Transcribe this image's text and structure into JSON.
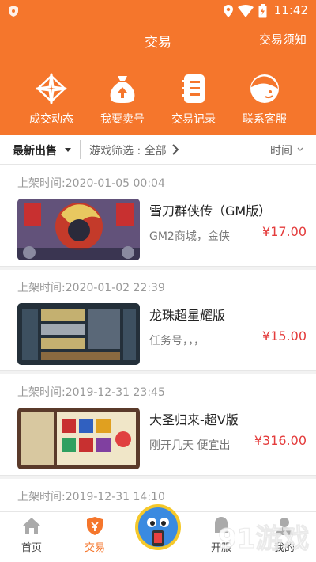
{
  "status_bar": {
    "time": "11:42"
  },
  "header": {
    "title": "交易",
    "notice_link": "交易须知",
    "features": [
      {
        "label": "成交动态",
        "icon": "deal-activity-icon"
      },
      {
        "label": "我要卖号",
        "icon": "money-bag-icon"
      },
      {
        "label": "交易记录",
        "icon": "record-book-icon"
      },
      {
        "label": "联系客服",
        "icon": "customer-service-icon"
      }
    ]
  },
  "filter_bar": {
    "sort_label": "最新出售",
    "game_filter": "游戏筛选 : 全部",
    "time_label": "时间"
  },
  "listings": [
    {
      "listed_time": "上架时间:2020-01-05 00:04",
      "name": "雪刀群侠传（GM版）",
      "desc": "GM2商城，金侠",
      "price": "¥17.00"
    },
    {
      "listed_time": "上架时间:2020-01-02 22:39",
      "name": "龙珠超星耀版",
      "desc": "任务号，，，",
      "price": "¥15.00"
    },
    {
      "listed_time": "上架时间:2019-12-31 23:45",
      "name": "大圣归来-超V版",
      "desc": "刚开几天 便宜出",
      "price": "¥316.00"
    },
    {
      "listed_time": "上架时间:2019-12-31 14:10"
    }
  ],
  "tabs": [
    {
      "label": "首页",
      "icon": "home-icon"
    },
    {
      "label": "交易",
      "icon": "trade-shield-icon",
      "active": true
    },
    {
      "label": "开服",
      "icon": "server-icon"
    },
    {
      "label": "我的",
      "icon": "profile-icon"
    }
  ],
  "watermark": {
    "text": "91游戏"
  },
  "colors": {
    "accent": "#f5762c",
    "price": "#e43c3c",
    "background": "#f2f2f2"
  }
}
